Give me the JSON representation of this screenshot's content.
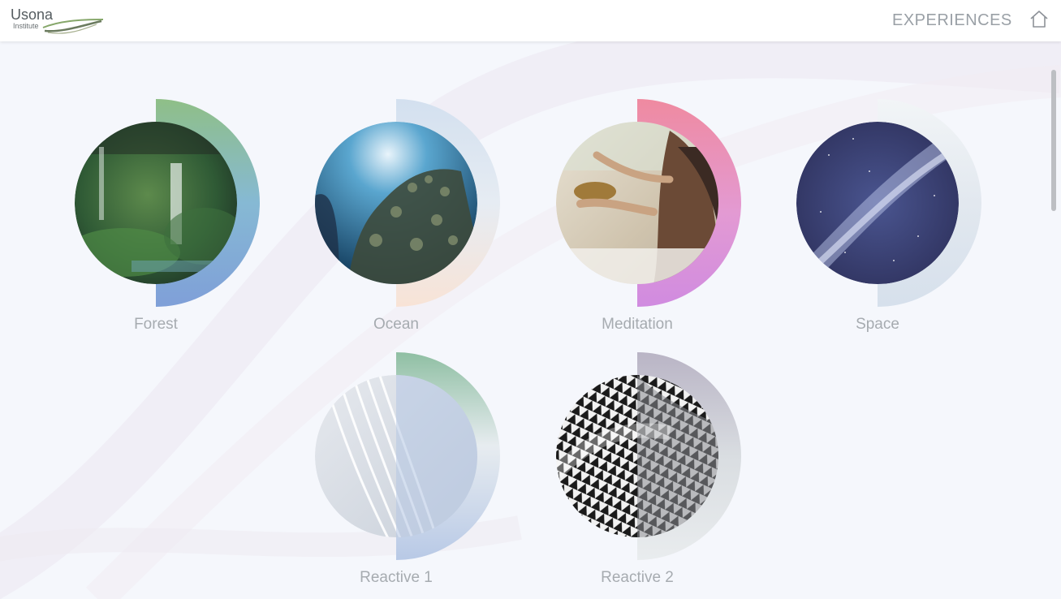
{
  "header": {
    "logo_word": "Usona",
    "logo_sub": "Institute",
    "nav_title": "EXPERIENCES",
    "home_icon": "home-icon"
  },
  "colors": {
    "background": "#f5f7fc",
    "header_bg": "#ffffff",
    "label_text": "#a6abb0",
    "nav_text": "#9aa0a6"
  },
  "experiences": [
    {
      "label": "Forest",
      "arc_colors": [
        "#8fbf87",
        "#86b9d4",
        "#7f9fd8"
      ],
      "image": "forest-waterfall"
    },
    {
      "label": "Ocean",
      "arc_colors": [
        "#d3e0ef",
        "#e6ecf3",
        "#f8e3d6"
      ],
      "image": "ocean-coral"
    },
    {
      "label": "Meditation",
      "arc_colors": [
        "#ef8aa0",
        "#e39ad3",
        "#d08be0"
      ],
      "image": "singing-bowl"
    },
    {
      "label": "Space",
      "arc_colors": [
        "#f2f5f7",
        "#e2e8ef",
        "#d6e0ec"
      ],
      "image": "milky-way"
    },
    {
      "label": "Reactive 1",
      "arc_colors": [
        "#8fbfa3",
        "#e7ecf0",
        "#b8c9e6"
      ],
      "image": "white-abstract"
    },
    {
      "label": "Reactive 2",
      "arc_colors": [
        "#b9b4c5",
        "#d9dde1",
        "#e9ecee"
      ],
      "image": "geometric-pattern"
    }
  ]
}
